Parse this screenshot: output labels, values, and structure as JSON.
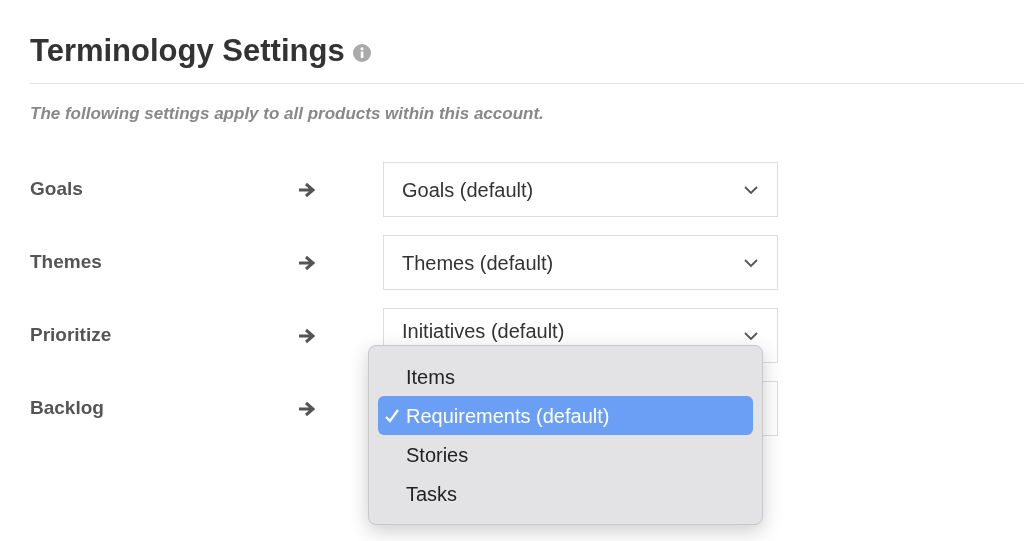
{
  "heading": {
    "title": "Terminology Settings"
  },
  "description": "The following settings apply to all products within this account.",
  "settings": [
    {
      "label": "Goals",
      "value": "Goals (default)"
    },
    {
      "label": "Themes",
      "value": "Themes (default)"
    },
    {
      "label": "Prioritize",
      "value": "Initiatives (default)"
    },
    {
      "label": "Backlog",
      "menu_open": true
    }
  ],
  "menu": {
    "options": [
      {
        "label": "Items",
        "selected": false
      },
      {
        "label": "Requirements (default)",
        "selected": true
      },
      {
        "label": "Stories",
        "selected": false
      },
      {
        "label": "Tasks",
        "selected": false
      }
    ]
  }
}
